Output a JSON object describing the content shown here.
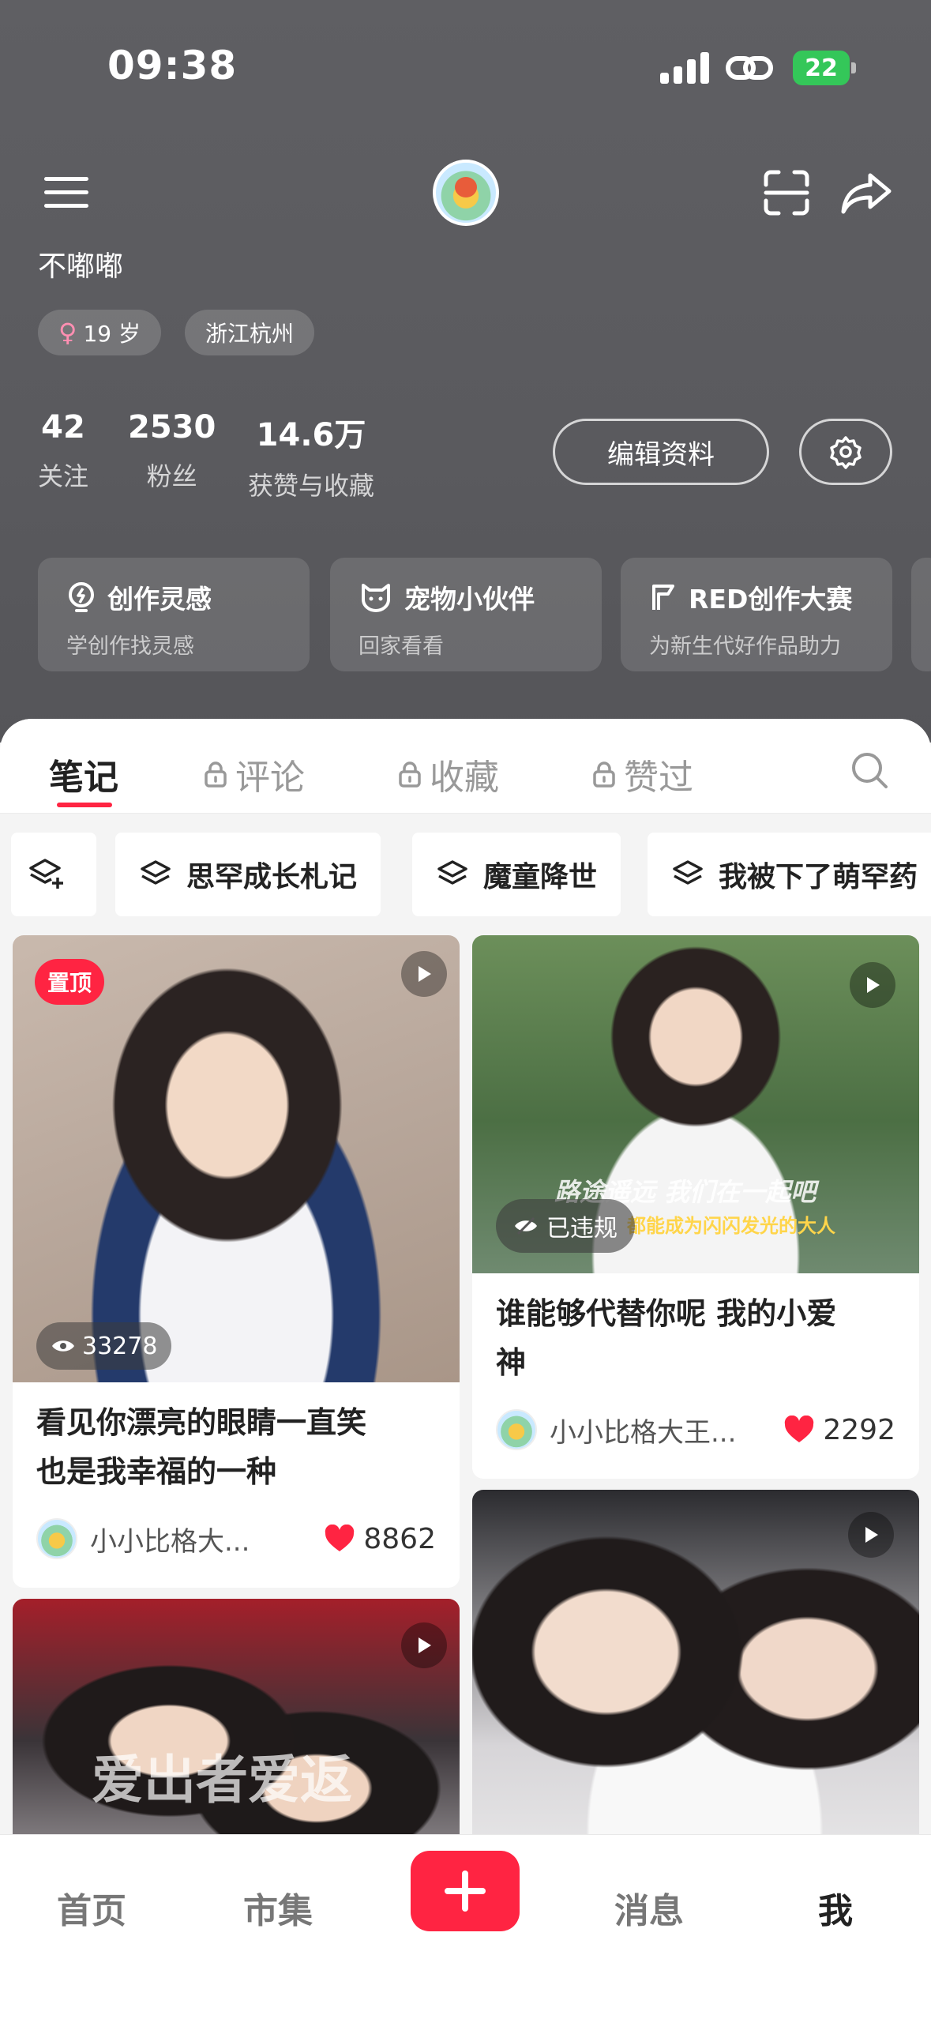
{
  "status_bar": {
    "time": "09:38",
    "battery": "22"
  },
  "profile": {
    "name": "不嘟嘟",
    "gender_symbol": "♀",
    "age": "19 岁",
    "location": "浙江杭州",
    "stats": [
      {
        "value": "42",
        "label": "关注"
      },
      {
        "value": "2530",
        "label": "粉丝"
      },
      {
        "value": "14.6万",
        "label": "获赞与收藏"
      }
    ],
    "edit_label": "编辑资料"
  },
  "features": [
    {
      "title": "创作灵感",
      "subtitle": "学创作找灵感",
      "icon": "bulb-icon"
    },
    {
      "title": "宠物小伙伴",
      "subtitle": "回家看看",
      "icon": "pet-icon"
    },
    {
      "title": "RED创作大赛",
      "subtitle": "为新生代好作品助力",
      "icon": "flag-icon"
    }
  ],
  "tabs": [
    {
      "label": "笔记",
      "active": true,
      "locked": false
    },
    {
      "label": "评论",
      "active": false,
      "locked": true
    },
    {
      "label": "收藏",
      "active": false,
      "locked": true
    },
    {
      "label": "赞过",
      "active": false,
      "locked": true
    }
  ],
  "collections": [
    "思罕成长札记",
    "魔童降世",
    "我被下了萌罕药"
  ],
  "notes": [
    {
      "pinned_label": "置顶",
      "views": "33278",
      "title_line1": "看见你漂亮的眼睛一直笑",
      "title_line2": "也是我幸福的一种",
      "author": "小小比格大...",
      "likes": "8862"
    },
    {
      "violation_label": "已违规",
      "overlay_line1": "路途遥远 我们在一起吧",
      "overlay_line2": "都能成为闪闪发光的大人",
      "title_line1": "谁能够代替你呢 我的小爱",
      "title_line2": "神",
      "author": "小小比格大王...",
      "likes": "2292"
    },
    {
      "overlay": "爱出者爱返"
    },
    {}
  ],
  "bottom_nav": {
    "home": "首页",
    "market": "市集",
    "messages": "消息",
    "me": "我"
  },
  "colors": {
    "brand_red": "#ff2442",
    "header_bg": "#5a5a5e"
  }
}
